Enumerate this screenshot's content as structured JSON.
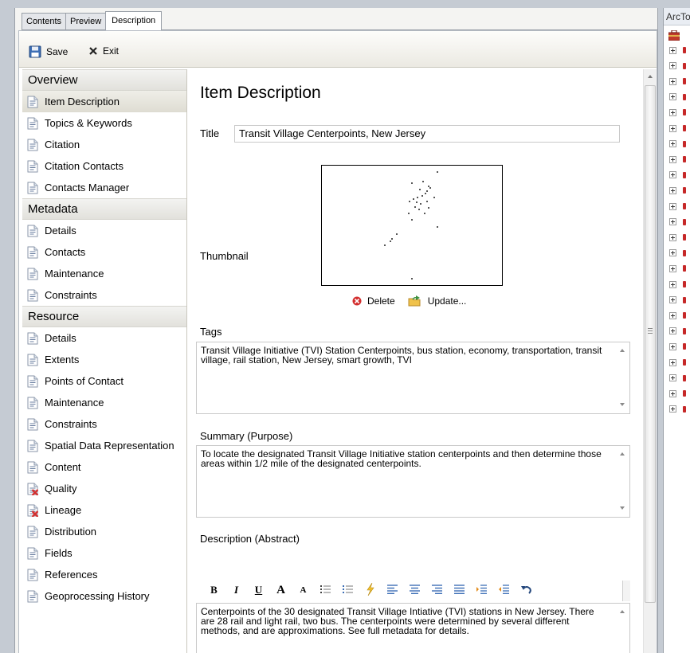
{
  "tabs": [
    {
      "label": "Contents",
      "active": false
    },
    {
      "label": "Preview",
      "active": false
    },
    {
      "label": "Description",
      "active": true
    }
  ],
  "toolbar": {
    "save_label": "Save",
    "exit_label": "Exit"
  },
  "sidebar": {
    "overview": {
      "title": "Overview",
      "items": [
        "Item Description",
        "Topics & Keywords",
        "Citation",
        "Citation Contacts",
        "Contacts Manager"
      ]
    },
    "metadata": {
      "title": "Metadata",
      "items": [
        "Details",
        "Contacts",
        "Maintenance",
        "Constraints"
      ]
    },
    "resource": {
      "title": "Resource",
      "items": [
        "Details",
        "Extents",
        "Points of Contact",
        "Maintenance",
        "Constraints",
        "Spatial Data Representation",
        "Content",
        "Quality",
        "Lineage",
        "Distribution",
        "Fields",
        "References",
        "Geoprocessing History"
      ]
    }
  },
  "content": {
    "page_title": "Item Description",
    "title_label": "Title",
    "title_value": "Transit Village Centerpoints, New Jersey",
    "thumbnail_label": "Thumbnail",
    "delete_label": "Delete",
    "update_label": "Update...",
    "tags_label": "Tags",
    "tags_value": "Transit Village Initiative (TVI) Station Centerpoints, bus station, economy, transportation, transit village, rail station, New Jersey, smart growth, TVI",
    "summary_label": "Summary (Purpose)",
    "summary_value": "To locate the designated Transit Village Initiative station centerpoints and then determine those areas within 1/2 mile of the designated centerpoints.",
    "description_label": "Description (Abstract)",
    "description_value": "Centerpoints of the 30 designated Transit Village Intiative (TVI) stations in New Jersey. There are 28 rail and light rail, two bus. The centerpoints were determined by several different methods, and are approximations. See full metadata for details."
  },
  "richtext_buttons": [
    "B",
    "I",
    "U",
    "A",
    "A"
  ],
  "right_panel": {
    "title": "ArcToolbox"
  },
  "icons": {
    "save": "floppy-disk-icon",
    "exit": "x-icon",
    "doc": "document-icon",
    "doc_error": "document-error-icon",
    "delete": "red-x-icon",
    "update": "folder-arrow-icon"
  },
  "colors": {
    "toolbar_bg": "#ebe9e2",
    "sidebar_head_bg": "#e2e1dc",
    "delete_red": "#d32f2f"
  }
}
